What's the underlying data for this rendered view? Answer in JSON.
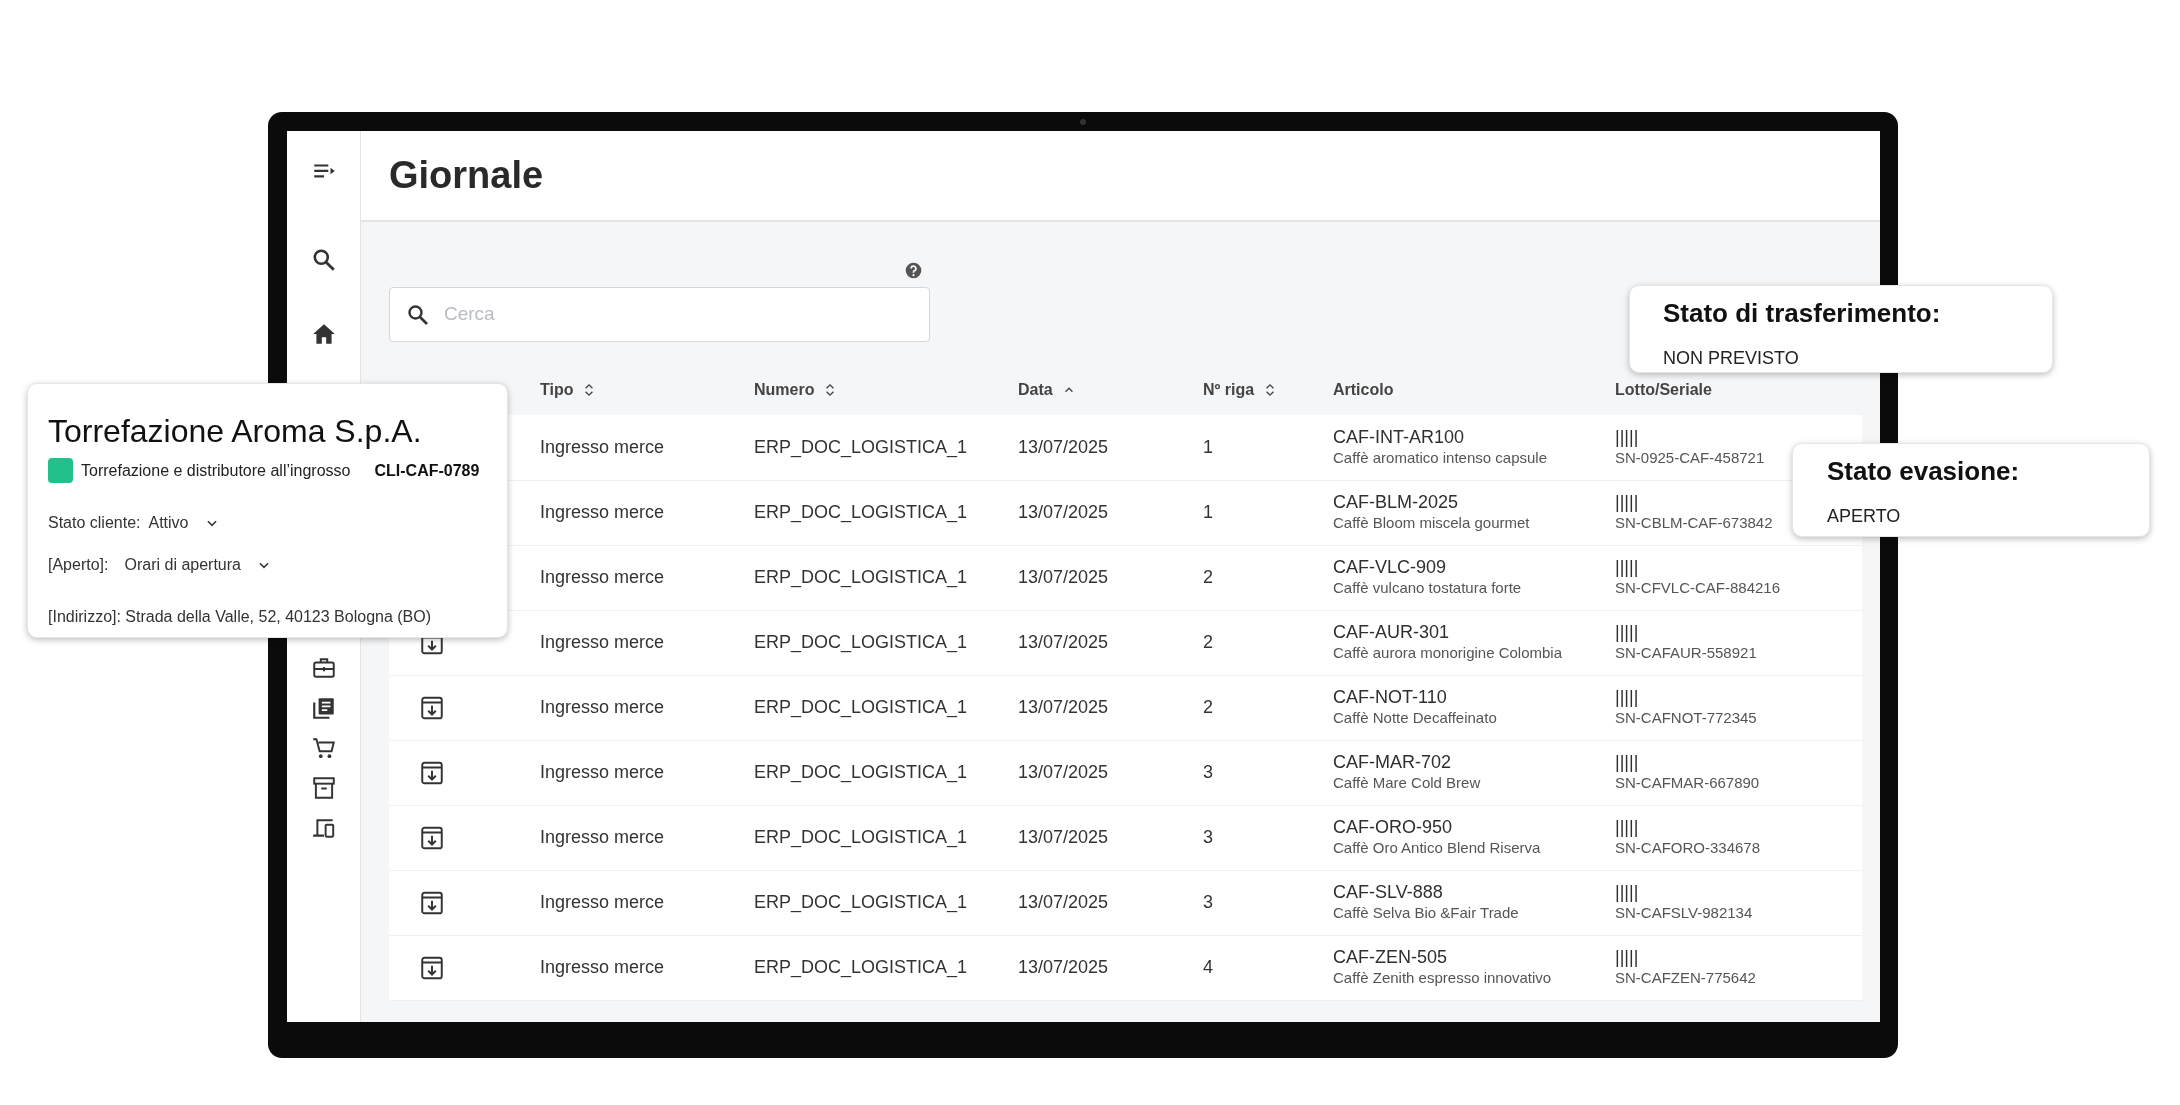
{
  "page_title": "Giornale",
  "search": {
    "placeholder": "Cerca"
  },
  "table": {
    "columns": [
      {
        "label": "Tipo",
        "sortable": true,
        "sorted_ascending": false
      },
      {
        "label": "Numero",
        "sortable": true,
        "sorted_ascending": false
      },
      {
        "label": "Data",
        "sortable": true,
        "sorted_ascending": true
      },
      {
        "label": "Nº riga",
        "sortable": true,
        "sorted_ascending": false
      },
      {
        "label": "Articolo",
        "sortable": false,
        "sorted_ascending": false
      },
      {
        "label": "Lotto/Seriale",
        "sortable": false,
        "sorted_ascending": false
      }
    ],
    "rows": [
      {
        "tipo": "Ingresso merce",
        "numero": "ERP_DOC_LOGISTICA_1",
        "data": "13/07/2025",
        "riga": "1",
        "articolo_code": "CAF-INT-AR100",
        "articolo_name": "Caffè aromatico intenso capsule",
        "barcode": "|||||",
        "serial": "SN-0925-CAF-458721"
      },
      {
        "tipo": "Ingresso merce",
        "numero": "ERP_DOC_LOGISTICA_1",
        "data": "13/07/2025",
        "riga": "1",
        "articolo_code": "CAF-BLM-2025",
        "articolo_name": "Caffè Bloom miscela gourmet",
        "barcode": "|||||",
        "serial": "SN-CBLM-CAF-673842"
      },
      {
        "tipo": "Ingresso merce",
        "numero": "ERP_DOC_LOGISTICA_1",
        "data": "13/07/2025",
        "riga": "2",
        "articolo_code": "CAF-VLC-909",
        "articolo_name": "Caffè vulcano tostatura forte",
        "barcode": "|||||",
        "serial": "SN-CFVLC-CAF-884216"
      },
      {
        "tipo": "Ingresso merce",
        "numero": "ERP_DOC_LOGISTICA_1",
        "data": "13/07/2025",
        "riga": "2",
        "articolo_code": "CAF-AUR-301",
        "articolo_name": "Caffè aurora monorigine Colombia",
        "barcode": "|||||",
        "serial": "SN-CAFAUR-558921"
      },
      {
        "tipo": "Ingresso merce",
        "numero": "ERP_DOC_LOGISTICA_1",
        "data": "13/07/2025",
        "riga": "2",
        "articolo_code": "CAF-NOT-110",
        "articolo_name": "Caffè Notte Decaffeinato",
        "barcode": "|||||",
        "serial": "SN-CAFNOT-772345"
      },
      {
        "tipo": "Ingresso merce",
        "numero": "ERP_DOC_LOGISTICA_1",
        "data": "13/07/2025",
        "riga": "3",
        "articolo_code": "CAF-MAR-702",
        "articolo_name": "Caffè Mare Cold Brew",
        "barcode": "|||||",
        "serial": "SN-CAFMAR-667890"
      },
      {
        "tipo": "Ingresso merce",
        "numero": "ERP_DOC_LOGISTICA_1",
        "data": "13/07/2025",
        "riga": "3",
        "articolo_code": "CAF-ORO-950",
        "articolo_name": "Caffè Oro Antico Blend Riserva",
        "barcode": "|||||",
        "serial": "SN-CAFORO-334678"
      },
      {
        "tipo": "Ingresso merce",
        "numero": "ERP_DOC_LOGISTICA_1",
        "data": "13/07/2025",
        "riga": "3",
        "articolo_code": "CAF-SLV-888",
        "articolo_name": "Caffè Selva Bio &Fair Trade",
        "barcode": "|||||",
        "serial": "SN-CAFSLV-982134"
      },
      {
        "tipo": "Ingresso merce",
        "numero": "ERP_DOC_LOGISTICA_1",
        "data": "13/07/2025",
        "riga": "4",
        "articolo_code": "CAF-ZEN-505",
        "articolo_name": "Caffè Zenith espresso innovativo",
        "barcode": "|||||",
        "serial": "SN-CAFZEN-775642"
      }
    ]
  },
  "customer_card": {
    "name": "Torrefazione Aroma S.p.A.",
    "category": {
      "label": "Torrefazione e distributore all’ingrosso",
      "color": "#22c08a"
    },
    "code": "CLI-CAF-0789",
    "fields": [
      {
        "label": "Stato cliente:",
        "value": "Attivo",
        "dropdown": true
      },
      {
        "label": "[Aperto]:",
        "value": "Orari di apertura",
        "dropdown": true
      }
    ],
    "address": "[Indirizzo]: Strada della Valle, 52, 40123 Bologna (BO)"
  },
  "status_popups": [
    {
      "title": "Stato di trasferimento:",
      "value": "NON PREVISTO"
    },
    {
      "title": "Stato evasione:",
      "value": "APERTO"
    }
  ]
}
